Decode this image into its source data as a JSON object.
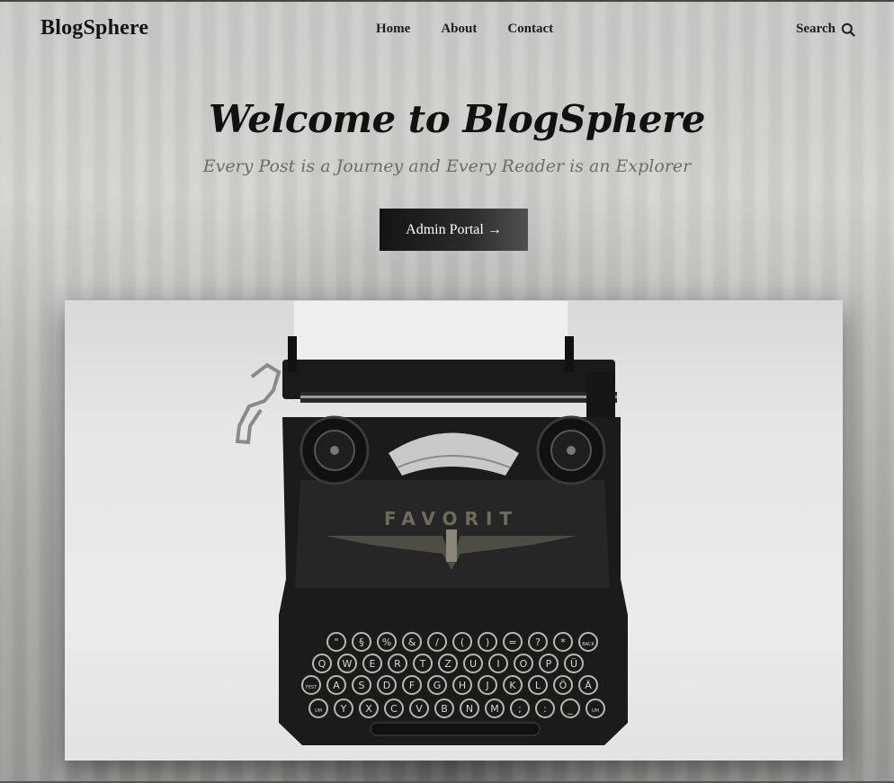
{
  "brand": {
    "name": "BlogSphere"
  },
  "nav": {
    "items": [
      {
        "label": "Home"
      },
      {
        "label": "About"
      },
      {
        "label": "Contact"
      }
    ],
    "search_label": "Search",
    "search_icon": "search-icon"
  },
  "hero": {
    "title": "Welcome to BlogSphere",
    "subtitle": "Every Post is a Journey and Every Reader is an Explorer",
    "button_label": "Admin Portal →"
  },
  "image": {
    "description_icon": "typewriter-illustration",
    "brand_text": "FAVORIT",
    "key_rows": [
      [
        "\"",
        "§",
        "%",
        "&",
        "/",
        "(",
        ")",
        "=",
        "?",
        "*",
        "BACK"
      ],
      [
        "Q",
        "W",
        "E",
        "R",
        "T",
        "Z",
        "U",
        "I",
        "O",
        "P",
        "Ü"
      ],
      [
        "FEST",
        "A",
        "S",
        "D",
        "F",
        "G",
        "H",
        "J",
        "K",
        "L",
        "Ö",
        "Ä"
      ],
      [
        "UM",
        "Y",
        "X",
        "C",
        "V",
        "B",
        "N",
        "M",
        ";",
        ":",
        "_",
        "UM"
      ]
    ]
  },
  "colors": {
    "button_bg": "#141414",
    "title_text": "#111111",
    "subtitle_text": "#6c6c6c"
  }
}
